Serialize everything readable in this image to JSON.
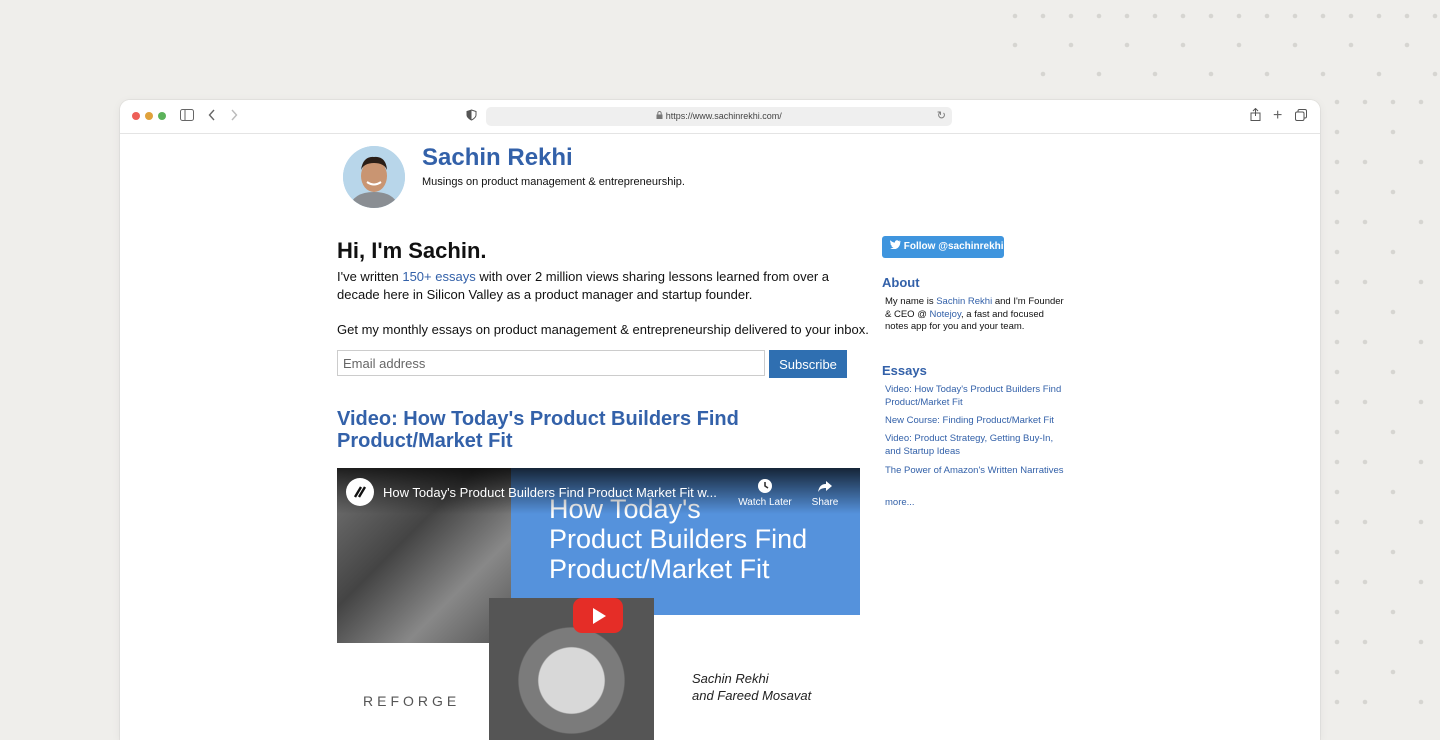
{
  "browser": {
    "url": "https://www.sachinrekhi.com/"
  },
  "site": {
    "title": "Sachin Rekhi",
    "tagline": "Musings on product management & entrepreneurship."
  },
  "main": {
    "greeting": "Hi, I'm Sachin.",
    "intro_prefix": "I've written ",
    "intro_link": "150+ essays",
    "intro_suffix": " with over 2 million views sharing lessons learned from over a decade here in Silicon Valley as a product manager and startup founder.",
    "newsletter_text": "Get my monthly essays on product management & entrepreneurship delivered to your inbox.",
    "email_placeholder": "Email address",
    "subscribe_label": "Subscribe",
    "post_title": "Video: How Today's Product Builders Find Product/Market Fit"
  },
  "video": {
    "title": "How Today's Product Builders Find Product Market Fit w...",
    "slide_text_1": "How Today's",
    "slide_text_2": "Product Builders Find",
    "slide_text_3": "Product/Market Fit",
    "watch_later": "Watch Later",
    "share": "Share",
    "brand": "REFORGE",
    "author_1": "Sachin Rekhi",
    "author_2": "and Fareed Mosavat"
  },
  "sidebar": {
    "follow_label": "Follow @sachinrekhi",
    "about_heading": "About",
    "about_pre": "My name is ",
    "about_name": "Sachin Rekhi",
    "about_mid": " and I'm Founder & CEO @ ",
    "about_company": "Notejoy",
    "about_post": ", a fast and focused notes app for you and your team.",
    "essays_heading": "Essays",
    "essays": [
      "Video: How Today's Product Builders Find Product/Market Fit",
      "New Course: Finding Product/Market Fit",
      "Video: Product Strategy, Getting Buy-In, and Startup Ideas",
      "The Power of Amazon's Written Narratives",
      "more..."
    ]
  }
}
